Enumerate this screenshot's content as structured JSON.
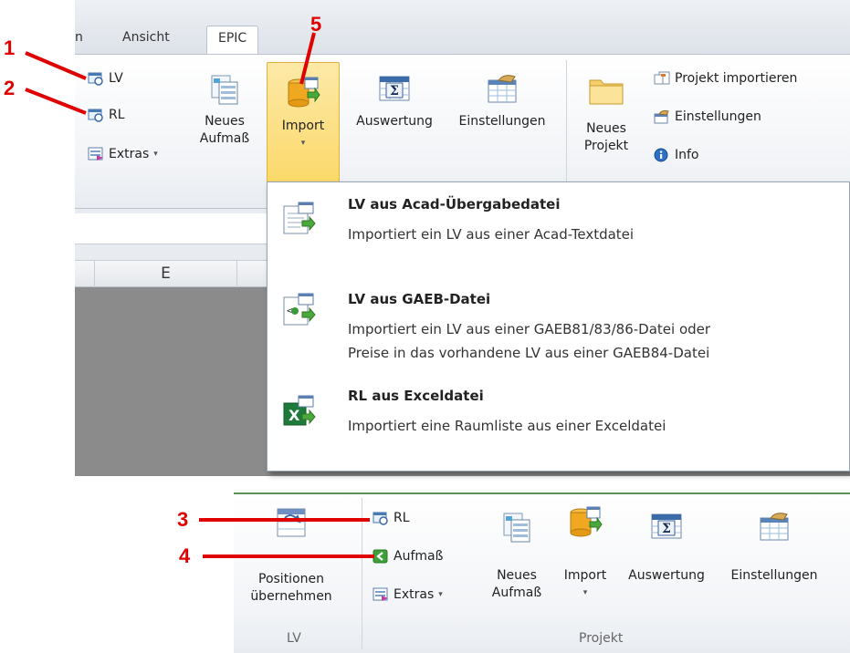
{
  "top": {
    "tabs": [
      {
        "label": "n"
      },
      {
        "label": "Ansicht"
      },
      {
        "label": "EPIC"
      }
    ],
    "left_buttons": {
      "lv": "LV",
      "rl": "RL",
      "extras": "Extras"
    },
    "big_buttons": {
      "neues_aufmass_line1": "Neues",
      "neues_aufmass_line2": "Aufmaß",
      "import": "Import",
      "auswertung": "Auswertung",
      "einstellungen": "Einstellungen",
      "neues_projekt_line1": "Neues",
      "neues_projekt_line2": "Projekt"
    },
    "right_buttons": {
      "projekt_importieren": "Projekt importieren",
      "einstellungen": "Einstellungen",
      "info": "Info"
    },
    "column_header": "E",
    "dropdown": [
      {
        "title": "LV aus Acad-Übergabedatei",
        "desc": [
          "Importiert ein LV aus einer Acad-Textdatei"
        ]
      },
      {
        "title": "LV aus GAEB-Datei",
        "desc": [
          "Importiert ein LV aus einer GAEB81/83/86-Datei oder",
          "Preise in das vorhandene LV aus einer GAEB84-Datei"
        ]
      },
      {
        "title": "RL aus Exceldatei",
        "desc": [
          "Importiert eine Raumliste aus einer Exceldatei"
        ]
      }
    ]
  },
  "bottom": {
    "positionen_line1": "Positionen",
    "positionen_line2": "übernehmen",
    "group_lv": "LV",
    "rl": "RL",
    "aufmass": "Aufmaß",
    "extras": "Extras",
    "neues_aufmass_line1": "Neues",
    "neues_aufmass_line2": "Aufmaß",
    "import": "Import",
    "auswertung": "Auswertung",
    "einstellungen": "Einstellungen",
    "group_projekt": "Projekt"
  },
  "annotations": [
    "1",
    "2",
    "3",
    "4",
    "5"
  ],
  "colors": {
    "annotation": "#e00000",
    "import_highlight": "#fbd96a"
  }
}
